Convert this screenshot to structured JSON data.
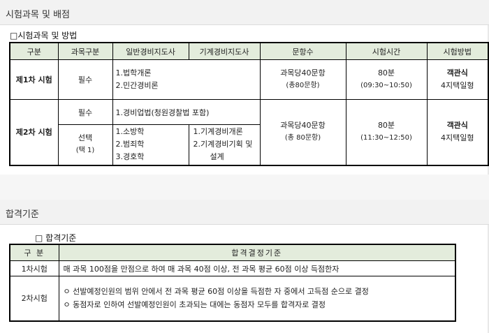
{
  "section1": {
    "title": "시험과목 및 배점",
    "subtitle": "□시험과목 및 방법",
    "headers": [
      "구분",
      "과목구분",
      "일반경비지도사",
      "기계경비지도사",
      "문항수",
      "시험시간",
      "시험방법"
    ],
    "exam1": {
      "label": "제1차 시험",
      "type": "필수",
      "subjects": [
        "1.법학개론",
        "2.민간경비론"
      ],
      "questions": [
        "과목당40문항",
        "(총80문항)"
      ],
      "time": [
        "80분",
        "(09:30~10:50)"
      ],
      "method": [
        "객관식",
        "4지택일형"
      ]
    },
    "exam2": {
      "label": "제2차 시험",
      "required_type": "필수",
      "required_subject": "1.경비업법(청원경찰법 포함)",
      "elective_type": [
        "선택",
        "(택 1)"
      ],
      "general_subjects": [
        "1.소방학",
        "2.범죄학",
        "3.경호학"
      ],
      "machine_subjects": [
        "1.기계경비개론",
        "2.기계경비기획 및",
        "설계"
      ],
      "questions": [
        "과목당40문항",
        "(총 80문항)"
      ],
      "time": [
        "80분",
        "(11:30~12:50)"
      ],
      "method": [
        "객관식",
        "4지택일형"
      ]
    }
  },
  "section2": {
    "title": "합격기준",
    "subtitle": "□ 합격기준",
    "headers": [
      "구 분",
      "합격결정기준"
    ],
    "row1": {
      "label": "1차시험",
      "text": "매 과목 100점을 만점으로 하여 매 과목 40점 이상, 전 과목 평균 60점 이상 득점한자"
    },
    "row2": {
      "label": "2차시험",
      "lines": [
        "ㅇ 선발예정인원의 범위 안에서 전 과목 평균 60점 이상을 득점한 자 중에서 고득점 순으로 결정",
        "ㅇ 동점자로 인하여 선발예정인원이 초과되는 대에는 동점자 모두를 합격자로 결정"
      ]
    }
  }
}
